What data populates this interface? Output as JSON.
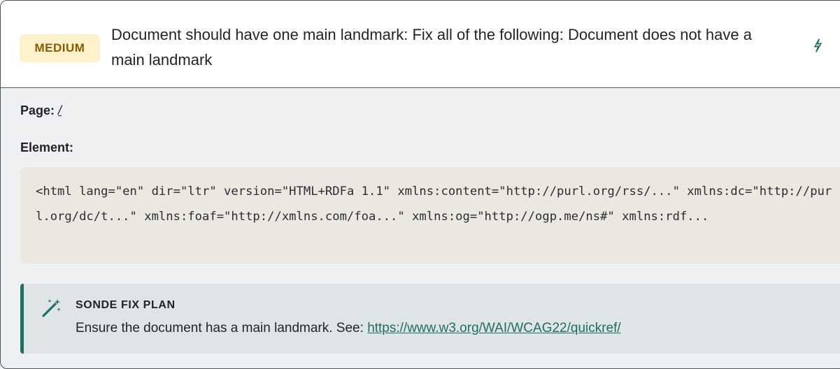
{
  "issue": {
    "severity": "MEDIUM",
    "title": "Document should have one main landmark: Fix all of the following: Document does not have a main landmark",
    "action_icon": "bolt-icon"
  },
  "details": {
    "page_label": "Page:",
    "page_link": "/",
    "element_label": "Element:",
    "element_code": "<html lang=\"en\" dir=\"ltr\" version=\"HTML+RDFa 1.1\" xmlns:content=\"http://purl.org/rss/...\" xmlns:dc=\"http://purl.org/dc/t...\" xmlns:foaf=\"http://xmlns.com/foa...\" xmlns:og=\"http://ogp.me/ns#\" xmlns:rdf..."
  },
  "fix_plan": {
    "icon": "magic-wand-icon",
    "heading": "SONDE FIX PLAN",
    "text": "Ensure the document has a main landmark. See:",
    "link": "https://www.w3.org/WAI/WCAG22/quickref/"
  },
  "colors": {
    "badge_bg": "#fdf2cc",
    "badge_text": "#8a5a00",
    "accent": "#1e6e66",
    "code_bg": "#ebe8e1",
    "fix_bg": "#dfe4e7"
  }
}
